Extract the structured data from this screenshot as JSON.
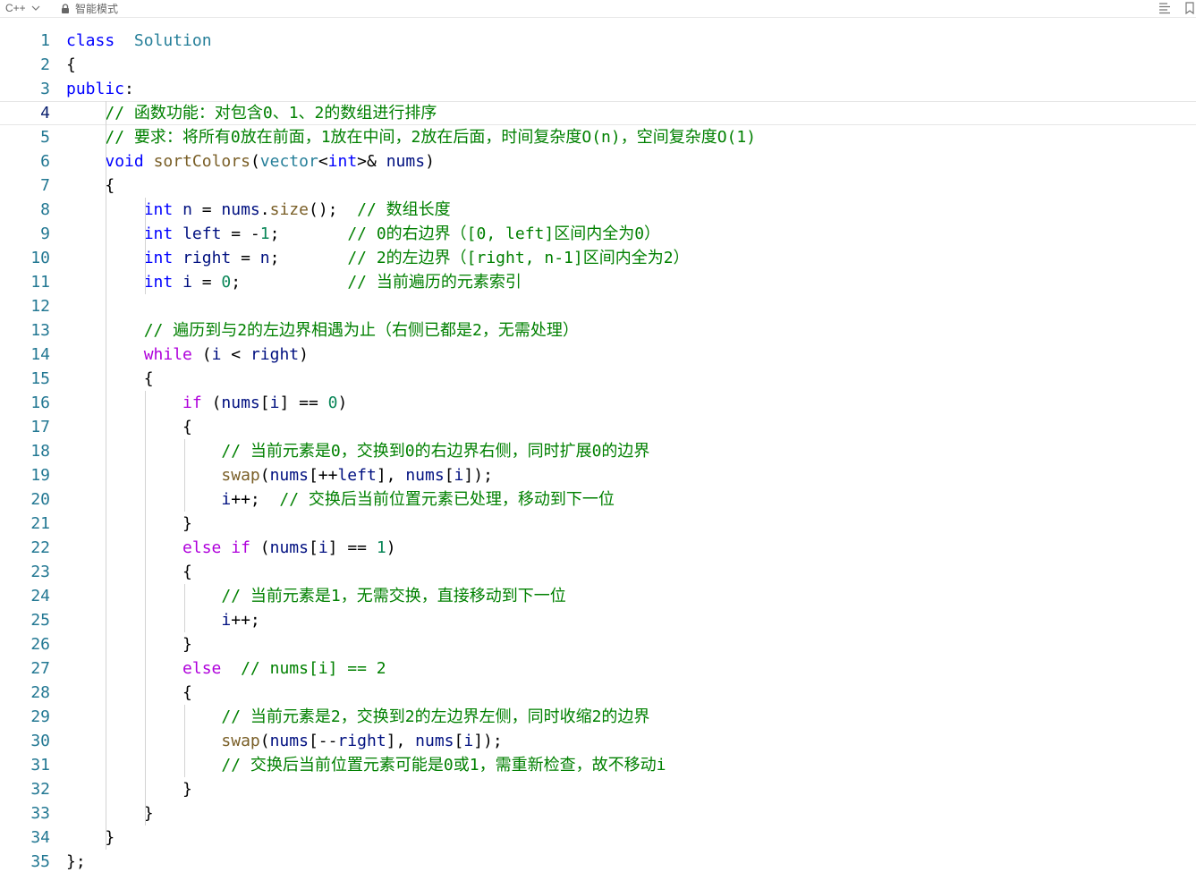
{
  "toolbar": {
    "language": "C++",
    "mode": "智能模式"
  },
  "icons": {
    "chevron": "chevron-down-icon",
    "lock": "lock-icon",
    "list": "list-icon",
    "bookmark": "bookmark-icon"
  },
  "colors": {
    "keyword": "#0000ff",
    "control": "#af00db",
    "type": "#267f99",
    "function": "#795e26",
    "variable": "#001080",
    "number": "#098658",
    "comment": "#008000",
    "line_number": "#237893"
  },
  "editor": {
    "active_line": 4,
    "lines": [
      {
        "n": "1",
        "tokens": [
          [
            "kw",
            "class"
          ],
          [
            "",
            "  "
          ],
          [
            "ty",
            "Solution"
          ]
        ]
      },
      {
        "n": "2",
        "tokens": [
          [
            "",
            "{"
          ]
        ]
      },
      {
        "n": "3",
        "tokens": [
          [
            "kw",
            "public"
          ],
          [
            "",
            ":"
          ]
        ]
      },
      {
        "n": "4",
        "tokens": [
          [
            "",
            "    "
          ],
          [
            "cm",
            "// 函数功能：对包含0、1、2的数组进行排序"
          ]
        ]
      },
      {
        "n": "5",
        "tokens": [
          [
            "",
            "    "
          ],
          [
            "cm",
            "// 要求：将所有0放在前面，1放在中间，2放在后面，时间复杂度O(n)，空间复杂度O(1)"
          ]
        ]
      },
      {
        "n": "6",
        "tokens": [
          [
            "",
            "    "
          ],
          [
            "kw",
            "void"
          ],
          [
            "",
            " "
          ],
          [
            "fn",
            "sortColors"
          ],
          [
            "",
            "("
          ],
          [
            "ty",
            "vector"
          ],
          [
            "",
            "<"
          ],
          [
            "kw",
            "int"
          ],
          [
            "",
            ">&"
          ],
          [
            "",
            " "
          ],
          [
            "var",
            "nums"
          ],
          [
            "",
            ")"
          ]
        ]
      },
      {
        "n": "7",
        "tokens": [
          [
            "",
            "    {"
          ]
        ]
      },
      {
        "n": "8",
        "tokens": [
          [
            "",
            "        "
          ],
          [
            "kw",
            "int"
          ],
          [
            "",
            " "
          ],
          [
            "var",
            "n"
          ],
          [
            "",
            " = "
          ],
          [
            "var",
            "nums"
          ],
          [
            "",
            "."
          ],
          [
            "fn",
            "size"
          ],
          [
            "",
            "();  "
          ],
          [
            "cm",
            "// 数组长度"
          ]
        ]
      },
      {
        "n": "9",
        "tokens": [
          [
            "",
            "        "
          ],
          [
            "kw",
            "int"
          ],
          [
            "",
            " "
          ],
          [
            "var",
            "left"
          ],
          [
            "",
            " = -"
          ],
          [
            "num",
            "1"
          ],
          [
            "",
            ";       "
          ],
          [
            "cm",
            "// 0的右边界（[0, left]区间内全为0）"
          ]
        ]
      },
      {
        "n": "10",
        "tokens": [
          [
            "",
            "        "
          ],
          [
            "kw",
            "int"
          ],
          [
            "",
            " "
          ],
          [
            "var",
            "right"
          ],
          [
            "",
            " = "
          ],
          [
            "var",
            "n"
          ],
          [
            "",
            ";       "
          ],
          [
            "cm",
            "// 2的左边界（[right, n-1]区间内全为2）"
          ]
        ]
      },
      {
        "n": "11",
        "tokens": [
          [
            "",
            "        "
          ],
          [
            "kw",
            "int"
          ],
          [
            "",
            " "
          ],
          [
            "var",
            "i"
          ],
          [
            "",
            " = "
          ],
          [
            "num",
            "0"
          ],
          [
            "",
            ";           "
          ],
          [
            "cm",
            "// 当前遍历的元素索引"
          ]
        ]
      },
      {
        "n": "12",
        "tokens": [
          [
            "",
            ""
          ]
        ]
      },
      {
        "n": "13",
        "tokens": [
          [
            "",
            "        "
          ],
          [
            "cm",
            "// 遍历到与2的左边界相遇为止（右侧已都是2，无需处理）"
          ]
        ]
      },
      {
        "n": "14",
        "tokens": [
          [
            "",
            "        "
          ],
          [
            "ctl",
            "while"
          ],
          [
            "",
            " ("
          ],
          [
            "var",
            "i"
          ],
          [
            "",
            " < "
          ],
          [
            "var",
            "right"
          ],
          [
            "",
            ")"
          ]
        ]
      },
      {
        "n": "15",
        "tokens": [
          [
            "",
            "        {"
          ]
        ]
      },
      {
        "n": "16",
        "tokens": [
          [
            "",
            "            "
          ],
          [
            "ctl",
            "if"
          ],
          [
            "",
            " ("
          ],
          [
            "var",
            "nums"
          ],
          [
            "",
            "["
          ],
          [
            "var",
            "i"
          ],
          [
            "",
            "] == "
          ],
          [
            "num",
            "0"
          ],
          [
            "",
            ")"
          ]
        ]
      },
      {
        "n": "17",
        "tokens": [
          [
            "",
            "            {"
          ]
        ]
      },
      {
        "n": "18",
        "tokens": [
          [
            "",
            "                "
          ],
          [
            "cm",
            "// 当前元素是0，交换到0的右边界右侧，同时扩展0的边界"
          ]
        ]
      },
      {
        "n": "19",
        "tokens": [
          [
            "",
            "                "
          ],
          [
            "fn",
            "swap"
          ],
          [
            "",
            "("
          ],
          [
            "var",
            "nums"
          ],
          [
            "",
            "[++"
          ],
          [
            "var",
            "left"
          ],
          [
            "",
            "], "
          ],
          [
            "var",
            "nums"
          ],
          [
            "",
            "["
          ],
          [
            "var",
            "i"
          ],
          [
            "",
            "]);"
          ]
        ]
      },
      {
        "n": "20",
        "tokens": [
          [
            "",
            "                "
          ],
          [
            "var",
            "i"
          ],
          [
            "",
            "++;  "
          ],
          [
            "cm",
            "// 交换后当前位置元素已处理，移动到下一位"
          ]
        ]
      },
      {
        "n": "21",
        "tokens": [
          [
            "",
            "            }"
          ]
        ]
      },
      {
        "n": "22",
        "tokens": [
          [
            "",
            "            "
          ],
          [
            "ctl",
            "else"
          ],
          [
            "",
            " "
          ],
          [
            "ctl",
            "if"
          ],
          [
            "",
            " ("
          ],
          [
            "var",
            "nums"
          ],
          [
            "",
            "["
          ],
          [
            "var",
            "i"
          ],
          [
            "",
            "] == "
          ],
          [
            "num",
            "1"
          ],
          [
            "",
            ")"
          ]
        ]
      },
      {
        "n": "23",
        "tokens": [
          [
            "",
            "            {"
          ]
        ]
      },
      {
        "n": "24",
        "tokens": [
          [
            "",
            "                "
          ],
          [
            "cm",
            "// 当前元素是1，无需交换，直接移动到下一位"
          ]
        ]
      },
      {
        "n": "25",
        "tokens": [
          [
            "",
            "                "
          ],
          [
            "var",
            "i"
          ],
          [
            "",
            "++;"
          ]
        ]
      },
      {
        "n": "26",
        "tokens": [
          [
            "",
            "            }"
          ]
        ]
      },
      {
        "n": "27",
        "tokens": [
          [
            "",
            "            "
          ],
          [
            "ctl",
            "else"
          ],
          [
            "",
            "  "
          ],
          [
            "cm",
            "// nums[i] == 2"
          ]
        ]
      },
      {
        "n": "28",
        "tokens": [
          [
            "",
            "            {"
          ]
        ]
      },
      {
        "n": "29",
        "tokens": [
          [
            "",
            "                "
          ],
          [
            "cm",
            "// 当前元素是2，交换到2的左边界左侧，同时收缩2的边界"
          ]
        ]
      },
      {
        "n": "30",
        "tokens": [
          [
            "",
            "                "
          ],
          [
            "fn",
            "swap"
          ],
          [
            "",
            "("
          ],
          [
            "var",
            "nums"
          ],
          [
            "",
            "[--"
          ],
          [
            "var",
            "right"
          ],
          [
            "",
            "], "
          ],
          [
            "var",
            "nums"
          ],
          [
            "",
            "["
          ],
          [
            "var",
            "i"
          ],
          [
            "",
            "]);"
          ]
        ]
      },
      {
        "n": "31",
        "tokens": [
          [
            "",
            "                "
          ],
          [
            "cm",
            "// 交换后当前位置元素可能是0或1，需重新检查，故不移动i"
          ]
        ]
      },
      {
        "n": "32",
        "tokens": [
          [
            "",
            "            }"
          ]
        ]
      },
      {
        "n": "33",
        "tokens": [
          [
            "",
            "        }"
          ]
        ]
      },
      {
        "n": "34",
        "tokens": [
          [
            "",
            "    }"
          ]
        ]
      },
      {
        "n": "35",
        "tokens": [
          [
            "",
            "};"
          ]
        ]
      }
    ]
  }
}
